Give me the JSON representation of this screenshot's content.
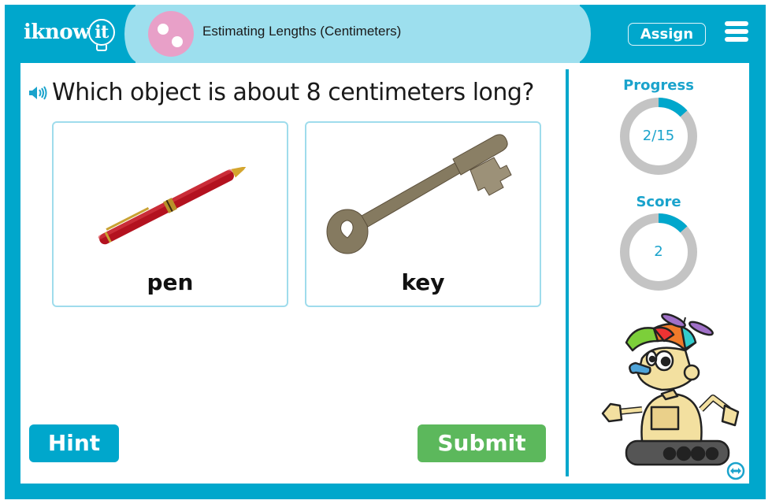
{
  "header": {
    "logo_text": "iknow",
    "logo_bulb_text": "it",
    "topic_title": "Estimating Lengths (Centimeters)",
    "assign_label": "Assign",
    "menu_icon": "hamburger-menu-icon",
    "topic_icon": "pink-circle-dots-icon"
  },
  "question": {
    "speaker_icon": "speaker-icon",
    "text": "Which object is about 8 centimeters long?"
  },
  "choices": [
    {
      "label": "pen",
      "image": "red-pen-image"
    },
    {
      "label": "key",
      "image": "skeleton-key-image"
    }
  ],
  "buttons": {
    "hint_label": "Hint",
    "submit_label": "Submit"
  },
  "sidebar": {
    "progress_title": "Progress",
    "progress_value": "2/15",
    "progress_current": 2,
    "progress_total": 15,
    "score_title": "Score",
    "score_value": "2",
    "score_fraction": 0.1333,
    "mascot": "robot-mascot-propeller-cap",
    "expand_icon": "expand-arrows-icon"
  },
  "colors": {
    "frame": "#00a7cc",
    "topic_pill": "#9ddfee",
    "topic_icon": "#e8a0c8",
    "hint": "#00a7cc",
    "submit": "#5cb85c",
    "ring_track": "#c4c4c4",
    "ring_fill": "#00a7cc"
  }
}
